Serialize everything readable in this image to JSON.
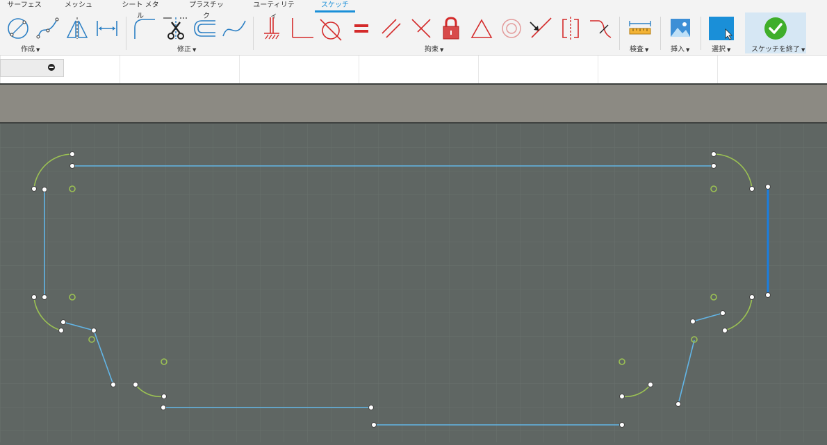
{
  "tabs": [
    {
      "label": "サーフェス",
      "active": false
    },
    {
      "label": "メッシュ",
      "active": false
    },
    {
      "label": "シート メタル",
      "active": false
    },
    {
      "label": "プラスチック",
      "active": false
    },
    {
      "label": "ユーティリティ",
      "active": false
    },
    {
      "label": "スケッチ",
      "active": true
    }
  ],
  "groups": {
    "create": "作成",
    "modify": "修正",
    "constraints": "拘束",
    "inspect": "検査",
    "insert": "挿入",
    "select": "選択",
    "finish": "スケッチを終了"
  },
  "tools": {
    "create": [
      "circle-icon",
      "spline-icon",
      "mirror-icon",
      "dimension-icon"
    ],
    "modify": [
      "fillet-icon",
      "trim-icon",
      "offset-icon",
      "curve-icon"
    ],
    "constraints": [
      "fix-icon",
      "perpendicular-icon",
      "tangent-icon",
      "equal-icon",
      "parallel-icon",
      "perpendicular-lines-icon",
      "lock-icon",
      "triangle-icon",
      "concentric-icon",
      "coincident-icon",
      "symmetry-icon",
      "curvature-icon"
    ]
  },
  "colors": {
    "accent": "#1a8fd8",
    "line": "#62b5e6",
    "selected_line": "#1a7fe0",
    "arc": "#9bc153",
    "constraint_red": "#d42a2a",
    "finish_green": "#3fae2a"
  }
}
